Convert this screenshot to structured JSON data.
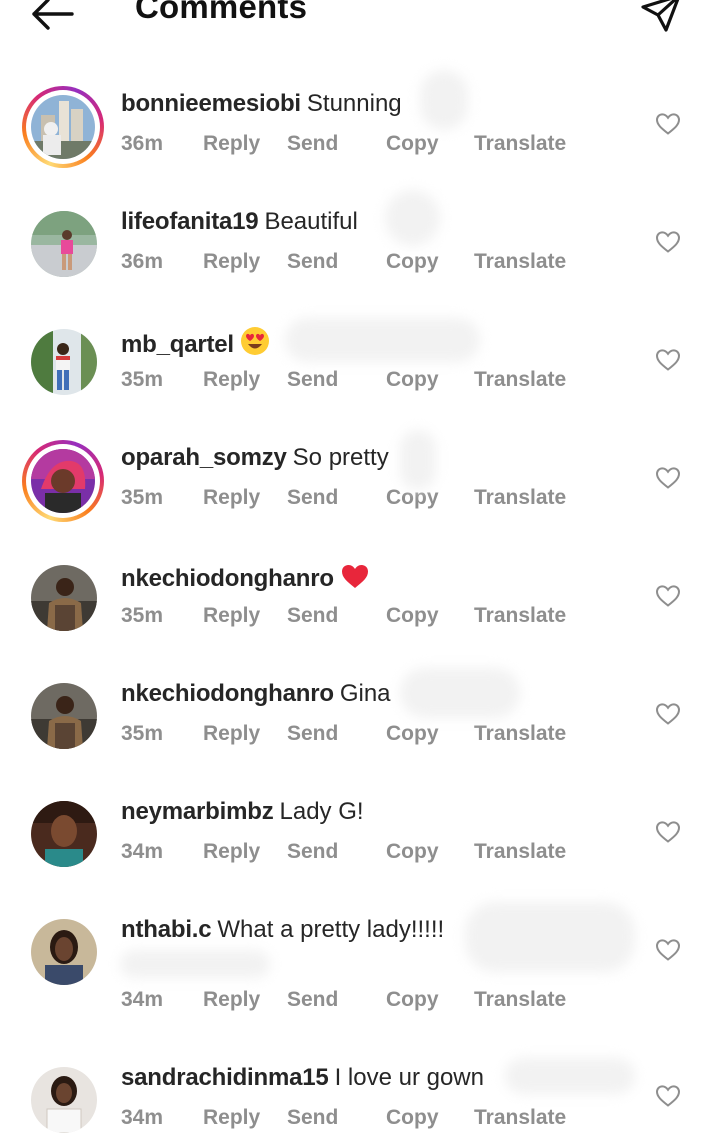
{
  "header": {
    "title": "Comments",
    "back_icon": "arrow-left-icon",
    "share_icon": "paper-plane-icon"
  },
  "action_labels": {
    "reply": "Reply",
    "send": "Send",
    "copy": "Copy",
    "translate": "Translate"
  },
  "colors": {
    "text": "#262626",
    "muted": "#8e8e8e",
    "story_ring": [
      "#feda75",
      "#fa7e1e",
      "#d62976",
      "#962fbf"
    ]
  },
  "comments": [
    {
      "username": "bonnieemesiobi",
      "text": "Stunning",
      "emoji": "",
      "time": "36m",
      "story_ring": true
    },
    {
      "username": "lifeofanita19",
      "text": "Beautiful",
      "emoji": "",
      "time": "36m",
      "story_ring": false
    },
    {
      "username": "mb_qartel",
      "text": "",
      "emoji": "heart-eyes-emoji",
      "time": "35m",
      "story_ring": false
    },
    {
      "username": "oparah_somzy",
      "text": "So pretty",
      "emoji": "",
      "time": "35m",
      "story_ring": true
    },
    {
      "username": "nkechiodonghanro",
      "text": "",
      "emoji": "red-heart-emoji",
      "time": "35m",
      "story_ring": false
    },
    {
      "username": "nkechiodonghanro",
      "text": "Gina",
      "emoji": "",
      "time": "35m",
      "story_ring": false
    },
    {
      "username": "neymarbimbz",
      "text": "Lady G!",
      "emoji": "",
      "time": "34m",
      "story_ring": false
    },
    {
      "username": "nthabi.c",
      "text": "What a pretty lady!!!!!",
      "emoji": "",
      "time": "34m",
      "story_ring": false
    },
    {
      "username": "sandrachidinma15",
      "text": "I love ur gown",
      "emoji": "",
      "time": "34m",
      "story_ring": false
    }
  ]
}
